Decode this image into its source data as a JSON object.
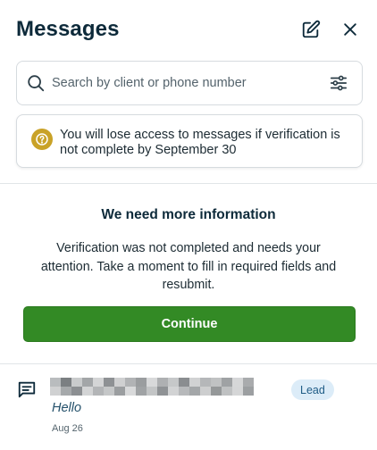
{
  "header": {
    "title": "Messages"
  },
  "search": {
    "placeholder": "Search by client or phone number"
  },
  "notice": {
    "text": "You will lose access to messages if verification is not complete by September 30"
  },
  "verification": {
    "title": "We need more information",
    "body": "Verification was not completed and needs your attention. Take a moment to fill in required fields and resubmit.",
    "continue_label": "Continue"
  },
  "threads": [
    {
      "preview": "Hello",
      "date": "Aug 26",
      "badge": "Lead"
    }
  ],
  "colors": {
    "accent_green": "#338a25",
    "warning_icon": "#c9a227",
    "badge_bg": "#dcecf8",
    "badge_text": "#1f5c86",
    "title_text": "#0d2a3a"
  },
  "icons": [
    "compose-icon",
    "close-icon",
    "search-icon",
    "filter-sliders-icon",
    "question-icon",
    "message-icon"
  ]
}
